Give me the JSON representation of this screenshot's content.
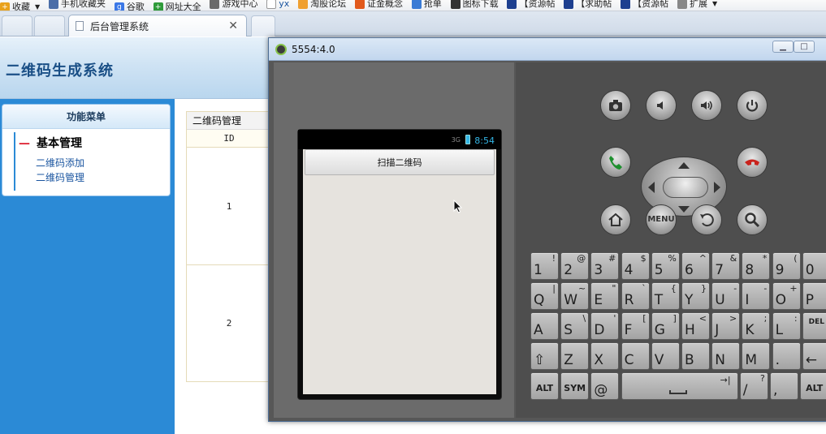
{
  "bookmarks": [
    "收藏",
    "手机收藏夹",
    "谷歌",
    "网址大全",
    "游戏中心",
    "yx",
    "淘股论坛",
    "证金概念",
    "抢单",
    "图标下载",
    "【资源帖",
    "【求助帖",
    "【资源帖",
    "扩展"
  ],
  "tab": {
    "title": "后台管理系统"
  },
  "header": {
    "title": "二维码生成系统"
  },
  "sidebar": {
    "heading": "功能菜单",
    "group": "基本管理",
    "links": [
      "二维码添加",
      "二维码管理"
    ]
  },
  "table": {
    "caption": "二维码管理",
    "header": "ID",
    "rows": [
      "1",
      "2"
    ]
  },
  "emulator": {
    "title": "5554:4.0",
    "clock": "8:54",
    "signal": "3G",
    "scan_button": "扫描二维码"
  },
  "hardware_buttons": {
    "menu": "MENU"
  },
  "keyboard": {
    "row1": [
      [
        "1",
        "!"
      ],
      [
        "2",
        "@"
      ],
      [
        "3",
        "#"
      ],
      [
        "4",
        "$"
      ],
      [
        "5",
        "%"
      ],
      [
        "6",
        "^"
      ],
      [
        "7",
        "&"
      ],
      [
        "8",
        "*"
      ],
      [
        "9",
        "("
      ],
      [
        "0",
        ""
      ]
    ],
    "row2": [
      [
        "Q",
        "|"
      ],
      [
        "W",
        "~"
      ],
      [
        "E",
        "\""
      ],
      [
        "R",
        "`"
      ],
      [
        "T",
        "{"
      ],
      [
        "Y",
        "}"
      ],
      [
        "U",
        "-"
      ],
      [
        "I",
        "-"
      ],
      [
        "O",
        "+"
      ],
      [
        "P",
        ""
      ]
    ],
    "row3": [
      [
        "A",
        ""
      ],
      [
        "S",
        "\\"
      ],
      [
        "D",
        "'"
      ],
      [
        "F",
        "["
      ],
      [
        "G",
        "]"
      ],
      [
        "H",
        "<"
      ],
      [
        "J",
        ">"
      ],
      [
        "K",
        ";"
      ],
      [
        "L",
        ":"
      ],
      [
        "DEL",
        ""
      ]
    ],
    "row4": [
      [
        "⇧",
        ""
      ],
      [
        "Z",
        ""
      ],
      [
        "X",
        ""
      ],
      [
        "C",
        ""
      ],
      [
        "V",
        ""
      ],
      [
        "B",
        ""
      ],
      [
        "N",
        ""
      ],
      [
        "M",
        ""
      ],
      [
        ".",
        ""
      ],
      [
        "←",
        ""
      ]
    ],
    "row5": [
      [
        "ALT",
        ""
      ],
      [
        "SYM",
        ""
      ],
      [
        "@",
        ""
      ],
      [
        "SPACE",
        ""
      ],
      [
        "/",
        "?"
      ],
      [
        ",",
        ""
      ],
      [
        "ALT",
        ""
      ]
    ]
  }
}
